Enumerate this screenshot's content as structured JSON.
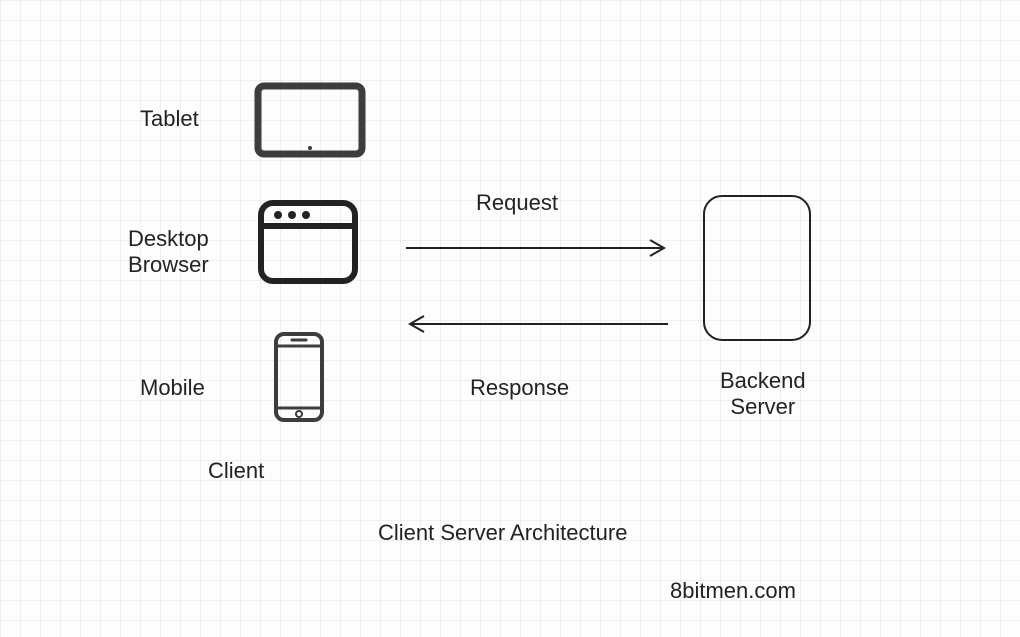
{
  "labels": {
    "tablet": "Tablet",
    "desktop_browser": "Desktop\nBrowser",
    "mobile": "Mobile",
    "client": "Client",
    "request": "Request",
    "response": "Response",
    "backend_server": "Backend\nServer",
    "title": "Client Server Architecture",
    "credit": "8bitmen.com"
  },
  "diagram": {
    "nodes": [
      "tablet",
      "desktop_browser",
      "mobile",
      "backend_server"
    ],
    "arrows": [
      {
        "from": "client",
        "to": "backend_server",
        "label": "request"
      },
      {
        "from": "backend_server",
        "to": "client",
        "label": "response"
      }
    ],
    "client_group": [
      "tablet",
      "desktop_browser",
      "mobile"
    ]
  },
  "colors": {
    "icon_stroke": "#3d3d3d",
    "arrow_stroke": "#222222",
    "text": "#222222",
    "grid": "rgba(0,0,0,0.05)"
  }
}
